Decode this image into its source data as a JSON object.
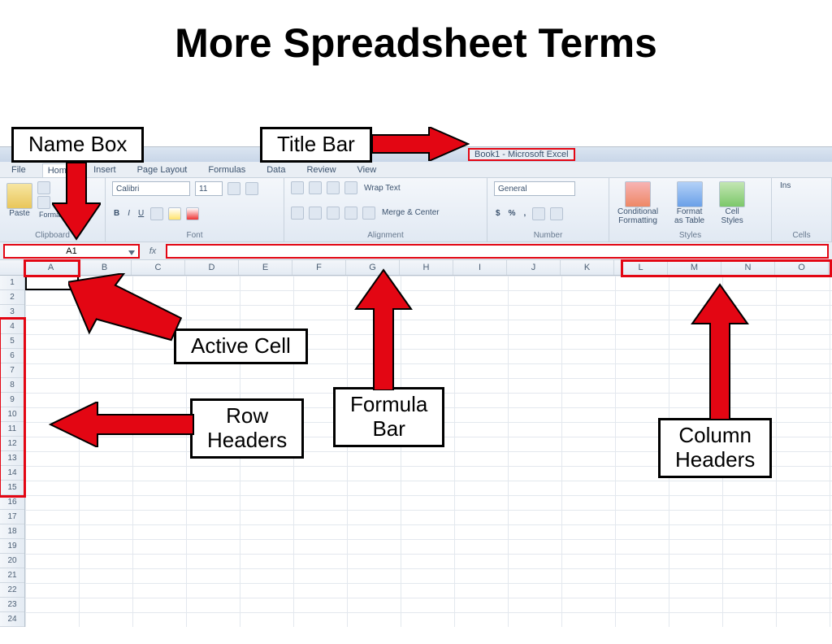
{
  "slide": {
    "title": "More Spreadsheet Terms"
  },
  "callouts": {
    "name_box": "Name Box",
    "title_bar": "Title Bar",
    "active_cell": "Active Cell",
    "row_headers": "Row\nHeaders",
    "formula_bar": "Formula\nBar",
    "column_headers": "Column\nHeaders"
  },
  "excel": {
    "title": "Book1  -  Microsoft Excel",
    "tabs": [
      "File",
      "Home",
      "Insert",
      "Page Layout",
      "Formulas",
      "Data",
      "Review",
      "View"
    ],
    "ribbon": {
      "clipboard": {
        "label": "Clipboard",
        "paste": "Paste",
        "painter": "Format Painter"
      },
      "font": {
        "label": "Font",
        "name": "Calibri",
        "size": "11"
      },
      "alignment": {
        "label": "Alignment",
        "wrap": "Wrap Text",
        "merge": "Merge & Center"
      },
      "number": {
        "label": "Number",
        "format": "General"
      },
      "styles": {
        "label": "Styles",
        "cond": "Conditional\nFormatting",
        "table": "Format\nas Table",
        "cell": "Cell\nStyles"
      },
      "cells": {
        "label": "Cells",
        "insert": "Ins"
      }
    },
    "name_box_value": "A1",
    "fx": "fx",
    "columns": [
      "A",
      "B",
      "C",
      "D",
      "E",
      "F",
      "G",
      "H",
      "I",
      "J",
      "K",
      "L",
      "M",
      "N",
      "O"
    ],
    "rows_count": 24
  }
}
